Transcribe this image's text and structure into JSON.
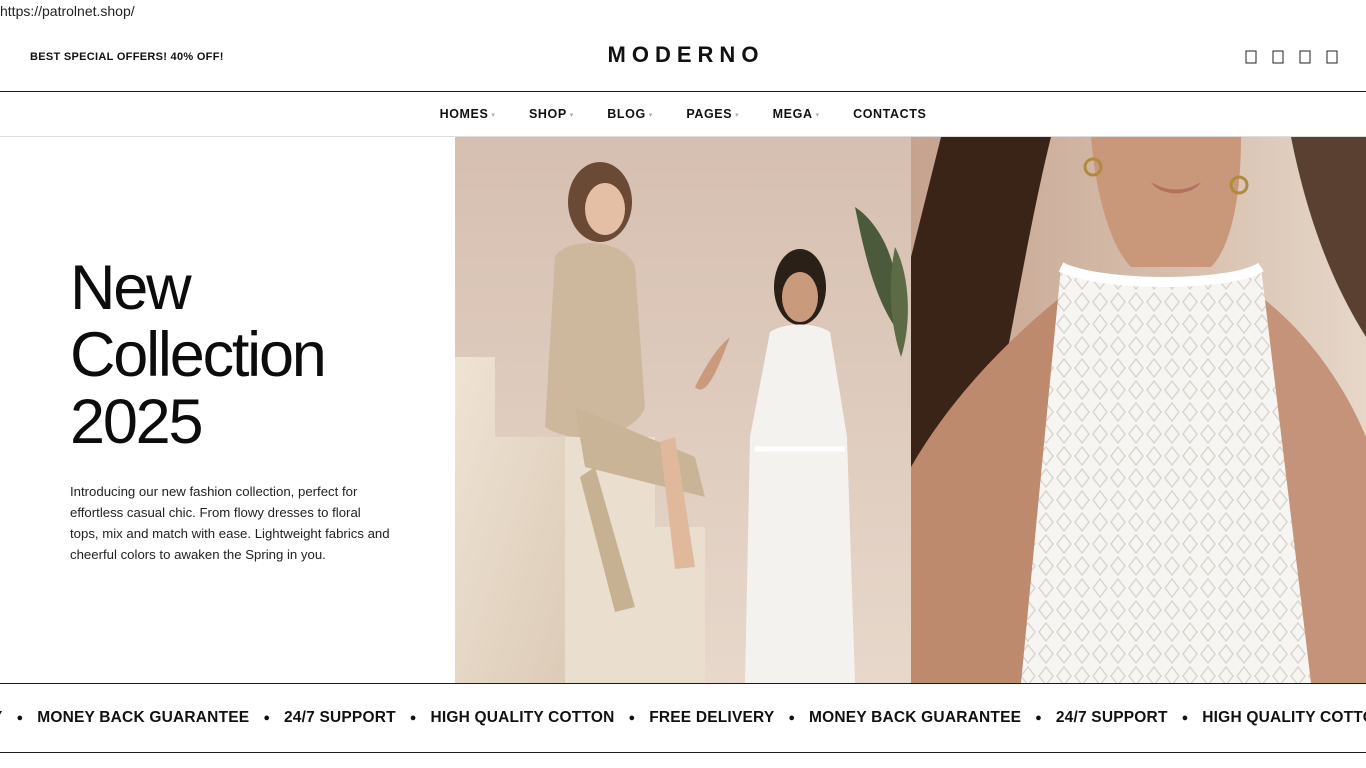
{
  "browser": {
    "url": "https://patrolnet.shop/"
  },
  "header": {
    "promo": "BEST SPECIAL OFFERS! 40% OFF!",
    "logo": "MODERNO",
    "icons": [
      "search-icon",
      "user-icon",
      "heart-icon",
      "cart-icon"
    ]
  },
  "nav": {
    "items": [
      {
        "label": "HOMES",
        "has_dropdown": true
      },
      {
        "label": "SHOP",
        "has_dropdown": true
      },
      {
        "label": "BLOG",
        "has_dropdown": true
      },
      {
        "label": "PAGES",
        "has_dropdown": true
      },
      {
        "label": "MEGA",
        "has_dropdown": true
      },
      {
        "label": "CONTACTS",
        "has_dropdown": false
      }
    ]
  },
  "hero": {
    "title_lines": [
      "New",
      "Collection",
      "2025"
    ],
    "description": "Introducing our new fashion collection, perfect for effortless casual chic. From flowy dresses to floral tops, mix and match with ease. Lightweight fabrics and cheerful colors to awaken the Spring in you."
  },
  "ticker": {
    "items": [
      "Y",
      "MONEY BACK GUARANTEE",
      "24/7 SUPPORT",
      "HIGH QUALITY COTTON",
      "FREE DELIVERY",
      "MONEY BACK GUARANTEE",
      "24/7 SUPPORT",
      "HIGH QUALITY COTTON"
    ]
  },
  "colors": {
    "text": "#111111",
    "border": "#1a1a1a",
    "hero_bg_1": "#d9c5b6",
    "hero_bg_2": "#cdb09d"
  }
}
